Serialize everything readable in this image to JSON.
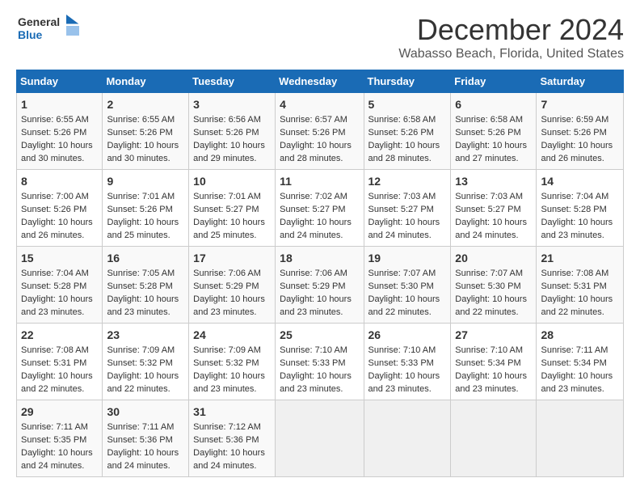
{
  "logo": {
    "line1": "General",
    "line2": "Blue"
  },
  "title": "December 2024",
  "subtitle": "Wabasso Beach, Florida, United States",
  "days_of_week": [
    "Sunday",
    "Monday",
    "Tuesday",
    "Wednesday",
    "Thursday",
    "Friday",
    "Saturday"
  ],
  "weeks": [
    [
      {
        "day": "1",
        "sunrise": "6:55 AM",
        "sunset": "5:26 PM",
        "daylight": "10 hours and 30 minutes."
      },
      {
        "day": "2",
        "sunrise": "6:55 AM",
        "sunset": "5:26 PM",
        "daylight": "10 hours and 30 minutes."
      },
      {
        "day": "3",
        "sunrise": "6:56 AM",
        "sunset": "5:26 PM",
        "daylight": "10 hours and 29 minutes."
      },
      {
        "day": "4",
        "sunrise": "6:57 AM",
        "sunset": "5:26 PM",
        "daylight": "10 hours and 28 minutes."
      },
      {
        "day": "5",
        "sunrise": "6:58 AM",
        "sunset": "5:26 PM",
        "daylight": "10 hours and 28 minutes."
      },
      {
        "day": "6",
        "sunrise": "6:58 AM",
        "sunset": "5:26 PM",
        "daylight": "10 hours and 27 minutes."
      },
      {
        "day": "7",
        "sunrise": "6:59 AM",
        "sunset": "5:26 PM",
        "daylight": "10 hours and 26 minutes."
      }
    ],
    [
      {
        "day": "8",
        "sunrise": "7:00 AM",
        "sunset": "5:26 PM",
        "daylight": "10 hours and 26 minutes."
      },
      {
        "day": "9",
        "sunrise": "7:01 AM",
        "sunset": "5:26 PM",
        "daylight": "10 hours and 25 minutes."
      },
      {
        "day": "10",
        "sunrise": "7:01 AM",
        "sunset": "5:27 PM",
        "daylight": "10 hours and 25 minutes."
      },
      {
        "day": "11",
        "sunrise": "7:02 AM",
        "sunset": "5:27 PM",
        "daylight": "10 hours and 24 minutes."
      },
      {
        "day": "12",
        "sunrise": "7:03 AM",
        "sunset": "5:27 PM",
        "daylight": "10 hours and 24 minutes."
      },
      {
        "day": "13",
        "sunrise": "7:03 AM",
        "sunset": "5:27 PM",
        "daylight": "10 hours and 24 minutes."
      },
      {
        "day": "14",
        "sunrise": "7:04 AM",
        "sunset": "5:28 PM",
        "daylight": "10 hours and 23 minutes."
      }
    ],
    [
      {
        "day": "15",
        "sunrise": "7:04 AM",
        "sunset": "5:28 PM",
        "daylight": "10 hours and 23 minutes."
      },
      {
        "day": "16",
        "sunrise": "7:05 AM",
        "sunset": "5:28 PM",
        "daylight": "10 hours and 23 minutes."
      },
      {
        "day": "17",
        "sunrise": "7:06 AM",
        "sunset": "5:29 PM",
        "daylight": "10 hours and 23 minutes."
      },
      {
        "day": "18",
        "sunrise": "7:06 AM",
        "sunset": "5:29 PM",
        "daylight": "10 hours and 23 minutes."
      },
      {
        "day": "19",
        "sunrise": "7:07 AM",
        "sunset": "5:30 PM",
        "daylight": "10 hours and 22 minutes."
      },
      {
        "day": "20",
        "sunrise": "7:07 AM",
        "sunset": "5:30 PM",
        "daylight": "10 hours and 22 minutes."
      },
      {
        "day": "21",
        "sunrise": "7:08 AM",
        "sunset": "5:31 PM",
        "daylight": "10 hours and 22 minutes."
      }
    ],
    [
      {
        "day": "22",
        "sunrise": "7:08 AM",
        "sunset": "5:31 PM",
        "daylight": "10 hours and 22 minutes."
      },
      {
        "day": "23",
        "sunrise": "7:09 AM",
        "sunset": "5:32 PM",
        "daylight": "10 hours and 22 minutes."
      },
      {
        "day": "24",
        "sunrise": "7:09 AM",
        "sunset": "5:32 PM",
        "daylight": "10 hours and 23 minutes."
      },
      {
        "day": "25",
        "sunrise": "7:10 AM",
        "sunset": "5:33 PM",
        "daylight": "10 hours and 23 minutes."
      },
      {
        "day": "26",
        "sunrise": "7:10 AM",
        "sunset": "5:33 PM",
        "daylight": "10 hours and 23 minutes."
      },
      {
        "day": "27",
        "sunrise": "7:10 AM",
        "sunset": "5:34 PM",
        "daylight": "10 hours and 23 minutes."
      },
      {
        "day": "28",
        "sunrise": "7:11 AM",
        "sunset": "5:34 PM",
        "daylight": "10 hours and 23 minutes."
      }
    ],
    [
      {
        "day": "29",
        "sunrise": "7:11 AM",
        "sunset": "5:35 PM",
        "daylight": "10 hours and 24 minutes."
      },
      {
        "day": "30",
        "sunrise": "7:11 AM",
        "sunset": "5:36 PM",
        "daylight": "10 hours and 24 minutes."
      },
      {
        "day": "31",
        "sunrise": "7:12 AM",
        "sunset": "5:36 PM",
        "daylight": "10 hours and 24 minutes."
      },
      null,
      null,
      null,
      null
    ]
  ],
  "labels": {
    "sunrise": "Sunrise:",
    "sunset": "Sunset:",
    "daylight": "Daylight:"
  }
}
